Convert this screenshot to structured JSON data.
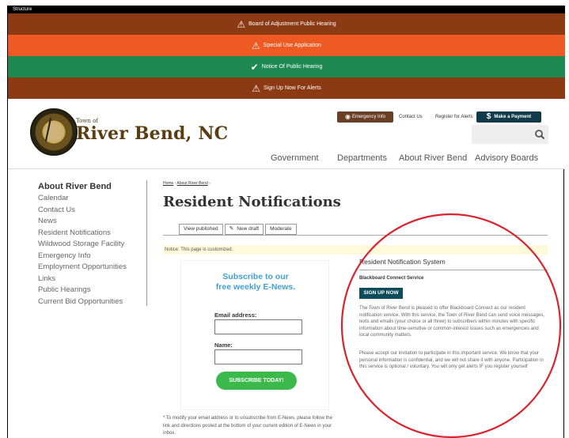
{
  "structure_bar": {
    "label": "Structure"
  },
  "alerts": [
    {
      "icon": "warning-icon",
      "text": "Board of Adjustment Public Hearing",
      "color": "#8b3a14"
    },
    {
      "icon": "warning-icon",
      "text": "Special Use Application",
      "color": "#ee5a24"
    },
    {
      "icon": "check-icon",
      "text": "Notice Of Public Hearing",
      "color": "#1e8a52"
    },
    {
      "icon": "warning-icon",
      "text": "Sign Up Now For Alerts",
      "color": "#8b3a14"
    }
  ],
  "header": {
    "brand_small": "Town of",
    "brand_big": "River Bend, NC",
    "emergency": "Emergency Info",
    "contact": "Contact Us",
    "register": "Register for Alerts",
    "payment": "Make a Payment",
    "payment_icon": "dollar-icon",
    "search_icon": "search-icon"
  },
  "nav": [
    "Government",
    "Departments",
    "About River Bend",
    "Advisory Boards"
  ],
  "sidebar": {
    "title": "About River Bend",
    "items": [
      "Calendar",
      "Contact Us",
      "News",
      "Resident Notifications",
      "Wildwood Storage Facility",
      "Emergency Info",
      "Employment Opportunities",
      "Links",
      "Public Hearings",
      "Current Bid Opportunities"
    ]
  },
  "breadcrumb": {
    "home": "Home",
    "about": "About River Bend"
  },
  "page_title": "Resident Notifications",
  "tabs": [
    "View published",
    "New draft",
    "Moderate"
  ],
  "notice": "Notice: This page is customized.",
  "subscribe": {
    "title_line1": "Subscribe to our",
    "title_line2": "free weekly  E-News.",
    "email_label": "Email address:",
    "name_label": "Name:",
    "button": "SUBSCRIBE TODAY!",
    "note": "* To modify your email address or to unsubscribe from E-News, please follow the link and directions posted at the bottom of your current edition of E-News in your inbox."
  },
  "notification": {
    "title": "Resident Notification System",
    "service": "Blackboard Connect Service",
    "signup": "SIGN UP NOW",
    "p1": "The Town of River Bend is pleased to offer Blackboard Connect as our resident notification service. With this service, the Town of River Bend can send voice messages, texts and emails (your choice or all three) to subscribers within minutes with specific information about time-sensitive or common-interest issues such as emergencies and local community matters.",
    "p2": "Please accept our invitation to participate in this important service. We know that your personal  information is confidential, and we will not share it with anyone. Participation in this service is optional / voluntary.  You will only get alerts IF you register yourself"
  },
  "colors": {
    "accent_blue": "#3fa0d8",
    "button_green": "#3bb94b",
    "signup_teal": "#0c4c5b",
    "annotation_red": "#d9232e"
  }
}
